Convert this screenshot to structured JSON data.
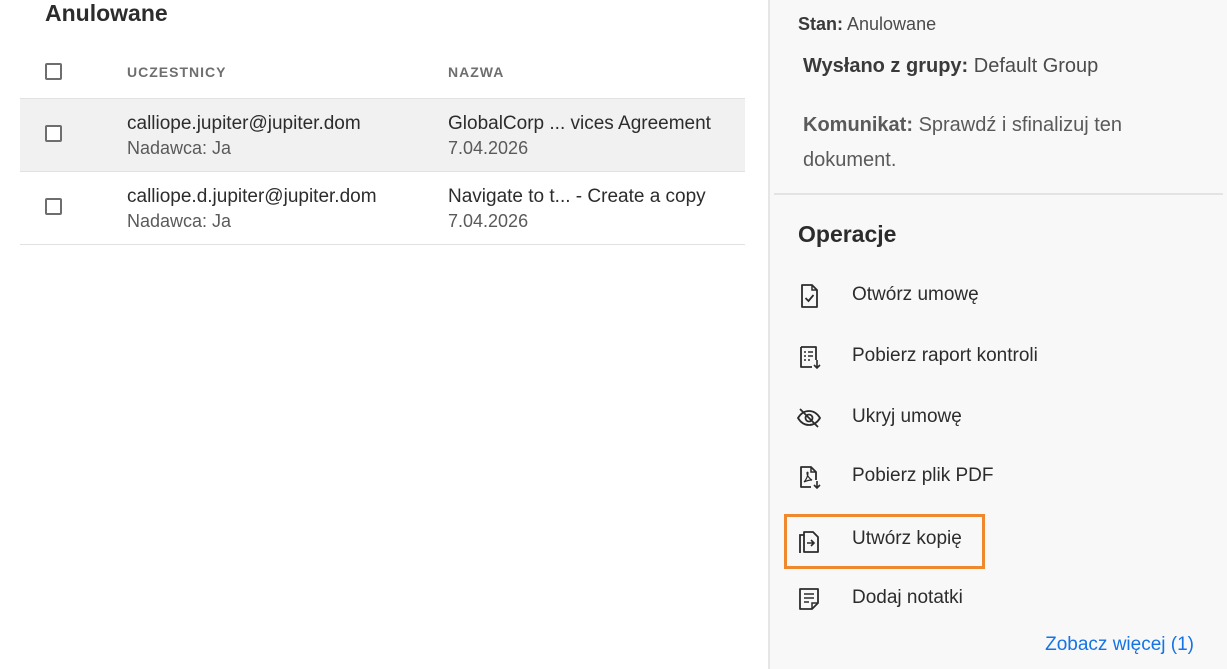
{
  "list": {
    "section_title": "Anulowane",
    "columns": {
      "participants": "UCZESTNICY",
      "name": "NAZWA"
    },
    "rows": [
      {
        "participant": "calliope.jupiter@jupiter.dom",
        "sender": "Nadawca: Ja",
        "name": "GlobalCorp ...  vices Agreement",
        "date": "7.04.2026",
        "selected": true
      },
      {
        "participant": "calliope.d.jupiter@jupiter.dom",
        "sender": "Nadawca: Ja",
        "name": "Navigate to t...  - Create a copy",
        "date": "7.04.2026",
        "selected": false
      }
    ]
  },
  "details": {
    "status_label": "Stan:",
    "status_value": "Anulowane",
    "group_label": "Wysłano z grupy:",
    "group_value": "Default Group",
    "message_label": "Komunikat:",
    "message_value": "Sprawdź i sfinalizuj ten",
    "message_value_line2": "dokument."
  },
  "operations": {
    "title": "Operacje",
    "items": [
      {
        "label": "Otwórz umowę",
        "icon": "document-check-icon"
      },
      {
        "label": "Pobierz raport kontroli",
        "icon": "audit-report-download-icon"
      },
      {
        "label": "Ukryj umowę",
        "icon": "eye-hidden-icon"
      },
      {
        "label": "Pobierz plik PDF",
        "icon": "pdf-download-icon"
      },
      {
        "label": "Utwórz kopię",
        "icon": "copy-document-icon",
        "highlighted": true
      },
      {
        "label": "Dodaj notatki",
        "icon": "notes-icon"
      }
    ],
    "see_more": "Zobacz więcej (1)"
  },
  "colors": {
    "accent_link": "#1473e6",
    "highlight_border": "#f0892e"
  }
}
